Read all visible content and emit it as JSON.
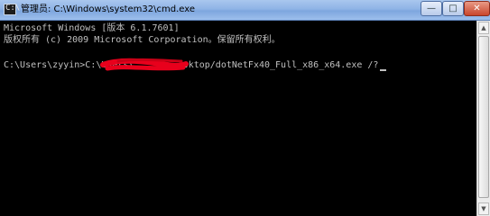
{
  "window": {
    "title": "管理员: C:\\Windows\\system32\\cmd.exe",
    "icon": "cmd-icon",
    "controls": {
      "minimize": "—",
      "maximize": "□",
      "close": "✕"
    }
  },
  "console": {
    "lines": [
      "Microsoft Windows [版本 6.1.7601]",
      "版权所有 (c) 2009 Microsoft Corporation。保留所有权利。",
      "C:\\Users\\zyyin>C:\\Users\\        esktop/dotNetFx40_Full_x86_x64.exe /?"
    ],
    "redaction_color": "#e8001c"
  },
  "scrollbar": {
    "up_arrow": "▲",
    "down_arrow": "▼",
    "thumb_fraction": 0.9
  }
}
